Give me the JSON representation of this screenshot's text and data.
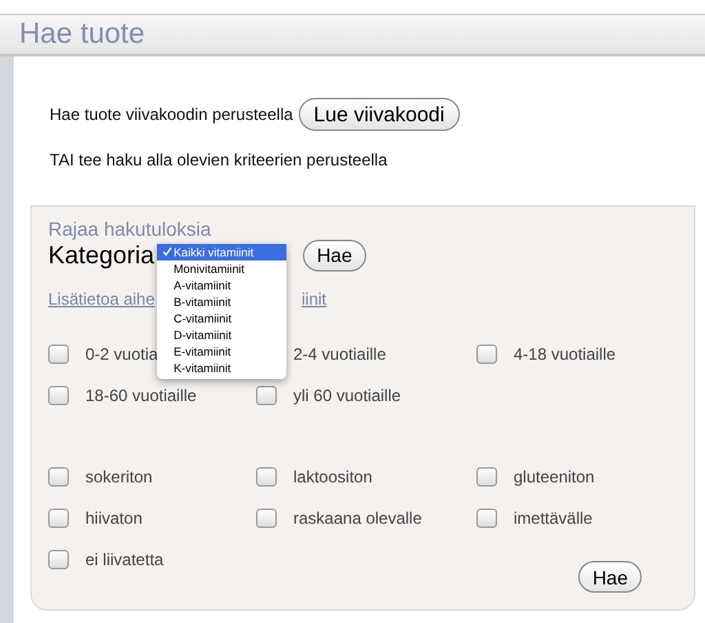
{
  "window": {
    "title": "Hae tuote"
  },
  "barcode": {
    "text": "Hae tuote viivakoodin perusteella",
    "button": "Lue viivakoodi"
  },
  "alternative_text": "TAI tee haku alla olevien kriteerien perusteella",
  "filter": {
    "heading": "Rajaa hakutuloksia",
    "category_label": "Kategoria",
    "search_button": "Hae",
    "dropdown": {
      "options": [
        {
          "label": "Kaikki vitamiinit",
          "selected": true
        },
        {
          "label": "Monivitamiinit",
          "selected": false
        },
        {
          "label": "A-vitamiinit",
          "selected": false
        },
        {
          "label": "B-vitamiinit",
          "selected": false
        },
        {
          "label": "C-vitamiinit",
          "selected": false
        },
        {
          "label": "D-vitamiinit",
          "selected": false
        },
        {
          "label": "E-vitamiinit",
          "selected": false
        },
        {
          "label": "K-vitamiinit",
          "selected": false
        }
      ]
    },
    "info_link": [
      "Lisätietoa aihe",
      "iinit"
    ],
    "age_options": [
      {
        "kind": "checkbox",
        "label": "0-2 vuotia",
        "checked": false
      },
      {
        "kind": "label",
        "label": "2-4 vuotiaille"
      },
      {
        "kind": "checkbox",
        "label": "4-18 vuotiaille",
        "checked": false
      },
      {
        "kind": "checkbox",
        "label": "18-60 vuotiaille",
        "checked": false
      },
      {
        "kind": "checkbox",
        "label": "yli 60 vuotiaille",
        "checked": false
      }
    ],
    "diet_options": [
      {
        "kind": "checkbox",
        "label": "sokeriton",
        "checked": false
      },
      {
        "kind": "checkbox",
        "label": "laktoositon",
        "checked": false
      },
      {
        "kind": "checkbox",
        "label": "gluteeniton",
        "checked": false
      },
      {
        "kind": "checkbox",
        "label": "hiivaton",
        "checked": false
      },
      {
        "kind": "checkbox",
        "label": "raskaana olevalle",
        "checked": false
      },
      {
        "kind": "checkbox",
        "label": "imettävälle",
        "checked": false
      },
      {
        "kind": "checkbox",
        "label": "ei liivatetta",
        "checked": false
      }
    ],
    "bottom_button": "Hae"
  }
}
